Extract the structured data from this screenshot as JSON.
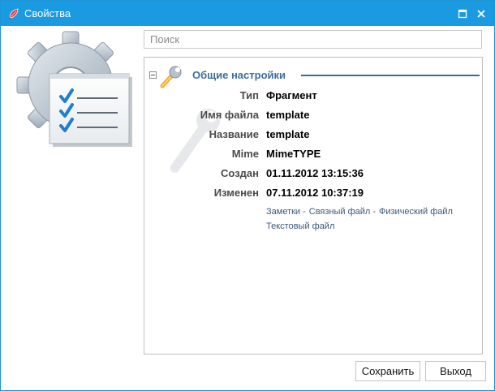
{
  "window": {
    "title": "Свойства",
    "title_icon": "feather-icon",
    "controls": {
      "maximize_icon": "maximize-icon",
      "close_icon": "close-icon"
    }
  },
  "hero_icon": "settings-checklist-icon",
  "search": {
    "placeholder": "Поиск",
    "value": ""
  },
  "section": {
    "title": "Общие настройки",
    "icon": "wrench-icon",
    "collapse_icon": "collapse-icon",
    "accent_color": "#2f6f9f"
  },
  "properties": [
    {
      "label": "Тип",
      "value": "Фрагмент"
    },
    {
      "label": "Имя файла",
      "value": "template"
    },
    {
      "label": "Название",
      "value": "template"
    },
    {
      "label": "Mime",
      "value": "MimeTYPE"
    },
    {
      "label": "Создан",
      "value": "01.11.2012 13:15:36"
    },
    {
      "label": "Изменен",
      "value": "07.11.2012 10:37:19"
    }
  ],
  "links": [
    "Заметки",
    "Связный файл",
    "Физический файл",
    "Текстовый файл"
  ],
  "link_separator": "-",
  "buttons": {
    "save": "Сохранить",
    "exit": "Выход"
  },
  "colors": {
    "titlebar": "#1a9ae0",
    "window_border": "#1d94d6",
    "link": "#3c5a78"
  }
}
